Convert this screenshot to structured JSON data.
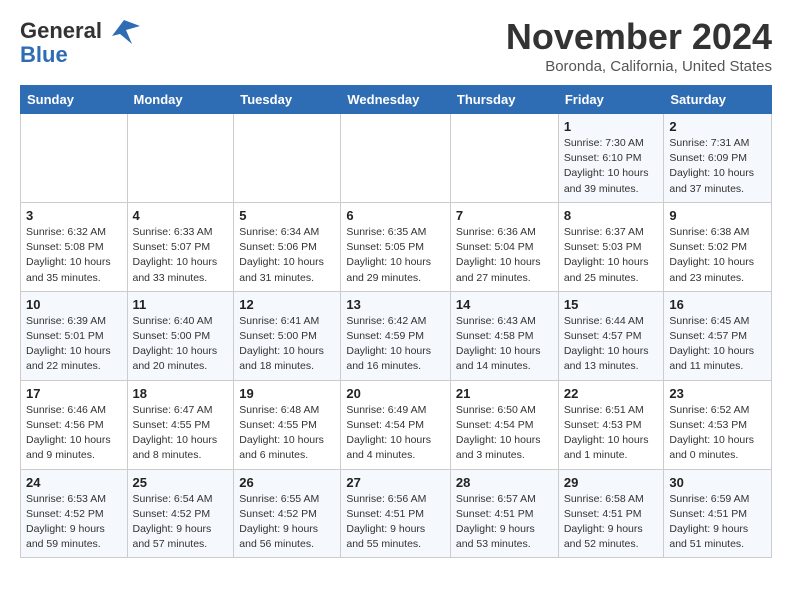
{
  "header": {
    "logo_general": "General",
    "logo_blue": "Blue",
    "month": "November 2024",
    "location": "Boronda, California, United States"
  },
  "weekdays": [
    "Sunday",
    "Monday",
    "Tuesday",
    "Wednesday",
    "Thursday",
    "Friday",
    "Saturday"
  ],
  "weeks": [
    [
      {
        "day": "",
        "info": ""
      },
      {
        "day": "",
        "info": ""
      },
      {
        "day": "",
        "info": ""
      },
      {
        "day": "",
        "info": ""
      },
      {
        "day": "",
        "info": ""
      },
      {
        "day": "1",
        "info": "Sunrise: 7:30 AM\nSunset: 6:10 PM\nDaylight: 10 hours\nand 39 minutes."
      },
      {
        "day": "2",
        "info": "Sunrise: 7:31 AM\nSunset: 6:09 PM\nDaylight: 10 hours\nand 37 minutes."
      }
    ],
    [
      {
        "day": "3",
        "info": "Sunrise: 6:32 AM\nSunset: 5:08 PM\nDaylight: 10 hours\nand 35 minutes."
      },
      {
        "day": "4",
        "info": "Sunrise: 6:33 AM\nSunset: 5:07 PM\nDaylight: 10 hours\nand 33 minutes."
      },
      {
        "day": "5",
        "info": "Sunrise: 6:34 AM\nSunset: 5:06 PM\nDaylight: 10 hours\nand 31 minutes."
      },
      {
        "day": "6",
        "info": "Sunrise: 6:35 AM\nSunset: 5:05 PM\nDaylight: 10 hours\nand 29 minutes."
      },
      {
        "day": "7",
        "info": "Sunrise: 6:36 AM\nSunset: 5:04 PM\nDaylight: 10 hours\nand 27 minutes."
      },
      {
        "day": "8",
        "info": "Sunrise: 6:37 AM\nSunset: 5:03 PM\nDaylight: 10 hours\nand 25 minutes."
      },
      {
        "day": "9",
        "info": "Sunrise: 6:38 AM\nSunset: 5:02 PM\nDaylight: 10 hours\nand 23 minutes."
      }
    ],
    [
      {
        "day": "10",
        "info": "Sunrise: 6:39 AM\nSunset: 5:01 PM\nDaylight: 10 hours\nand 22 minutes."
      },
      {
        "day": "11",
        "info": "Sunrise: 6:40 AM\nSunset: 5:00 PM\nDaylight: 10 hours\nand 20 minutes."
      },
      {
        "day": "12",
        "info": "Sunrise: 6:41 AM\nSunset: 5:00 PM\nDaylight: 10 hours\nand 18 minutes."
      },
      {
        "day": "13",
        "info": "Sunrise: 6:42 AM\nSunset: 4:59 PM\nDaylight: 10 hours\nand 16 minutes."
      },
      {
        "day": "14",
        "info": "Sunrise: 6:43 AM\nSunset: 4:58 PM\nDaylight: 10 hours\nand 14 minutes."
      },
      {
        "day": "15",
        "info": "Sunrise: 6:44 AM\nSunset: 4:57 PM\nDaylight: 10 hours\nand 13 minutes."
      },
      {
        "day": "16",
        "info": "Sunrise: 6:45 AM\nSunset: 4:57 PM\nDaylight: 10 hours\nand 11 minutes."
      }
    ],
    [
      {
        "day": "17",
        "info": "Sunrise: 6:46 AM\nSunset: 4:56 PM\nDaylight: 10 hours\nand 9 minutes."
      },
      {
        "day": "18",
        "info": "Sunrise: 6:47 AM\nSunset: 4:55 PM\nDaylight: 10 hours\nand 8 minutes."
      },
      {
        "day": "19",
        "info": "Sunrise: 6:48 AM\nSunset: 4:55 PM\nDaylight: 10 hours\nand 6 minutes."
      },
      {
        "day": "20",
        "info": "Sunrise: 6:49 AM\nSunset: 4:54 PM\nDaylight: 10 hours\nand 4 minutes."
      },
      {
        "day": "21",
        "info": "Sunrise: 6:50 AM\nSunset: 4:54 PM\nDaylight: 10 hours\nand 3 minutes."
      },
      {
        "day": "22",
        "info": "Sunrise: 6:51 AM\nSunset: 4:53 PM\nDaylight: 10 hours\nand 1 minute."
      },
      {
        "day": "23",
        "info": "Sunrise: 6:52 AM\nSunset: 4:53 PM\nDaylight: 10 hours\nand 0 minutes."
      }
    ],
    [
      {
        "day": "24",
        "info": "Sunrise: 6:53 AM\nSunset: 4:52 PM\nDaylight: 9 hours\nand 59 minutes."
      },
      {
        "day": "25",
        "info": "Sunrise: 6:54 AM\nSunset: 4:52 PM\nDaylight: 9 hours\nand 57 minutes."
      },
      {
        "day": "26",
        "info": "Sunrise: 6:55 AM\nSunset: 4:52 PM\nDaylight: 9 hours\nand 56 minutes."
      },
      {
        "day": "27",
        "info": "Sunrise: 6:56 AM\nSunset: 4:51 PM\nDaylight: 9 hours\nand 55 minutes."
      },
      {
        "day": "28",
        "info": "Sunrise: 6:57 AM\nSunset: 4:51 PM\nDaylight: 9 hours\nand 53 minutes."
      },
      {
        "day": "29",
        "info": "Sunrise: 6:58 AM\nSunset: 4:51 PM\nDaylight: 9 hours\nand 52 minutes."
      },
      {
        "day": "30",
        "info": "Sunrise: 6:59 AM\nSunset: 4:51 PM\nDaylight: 9 hours\nand 51 minutes."
      }
    ]
  ]
}
